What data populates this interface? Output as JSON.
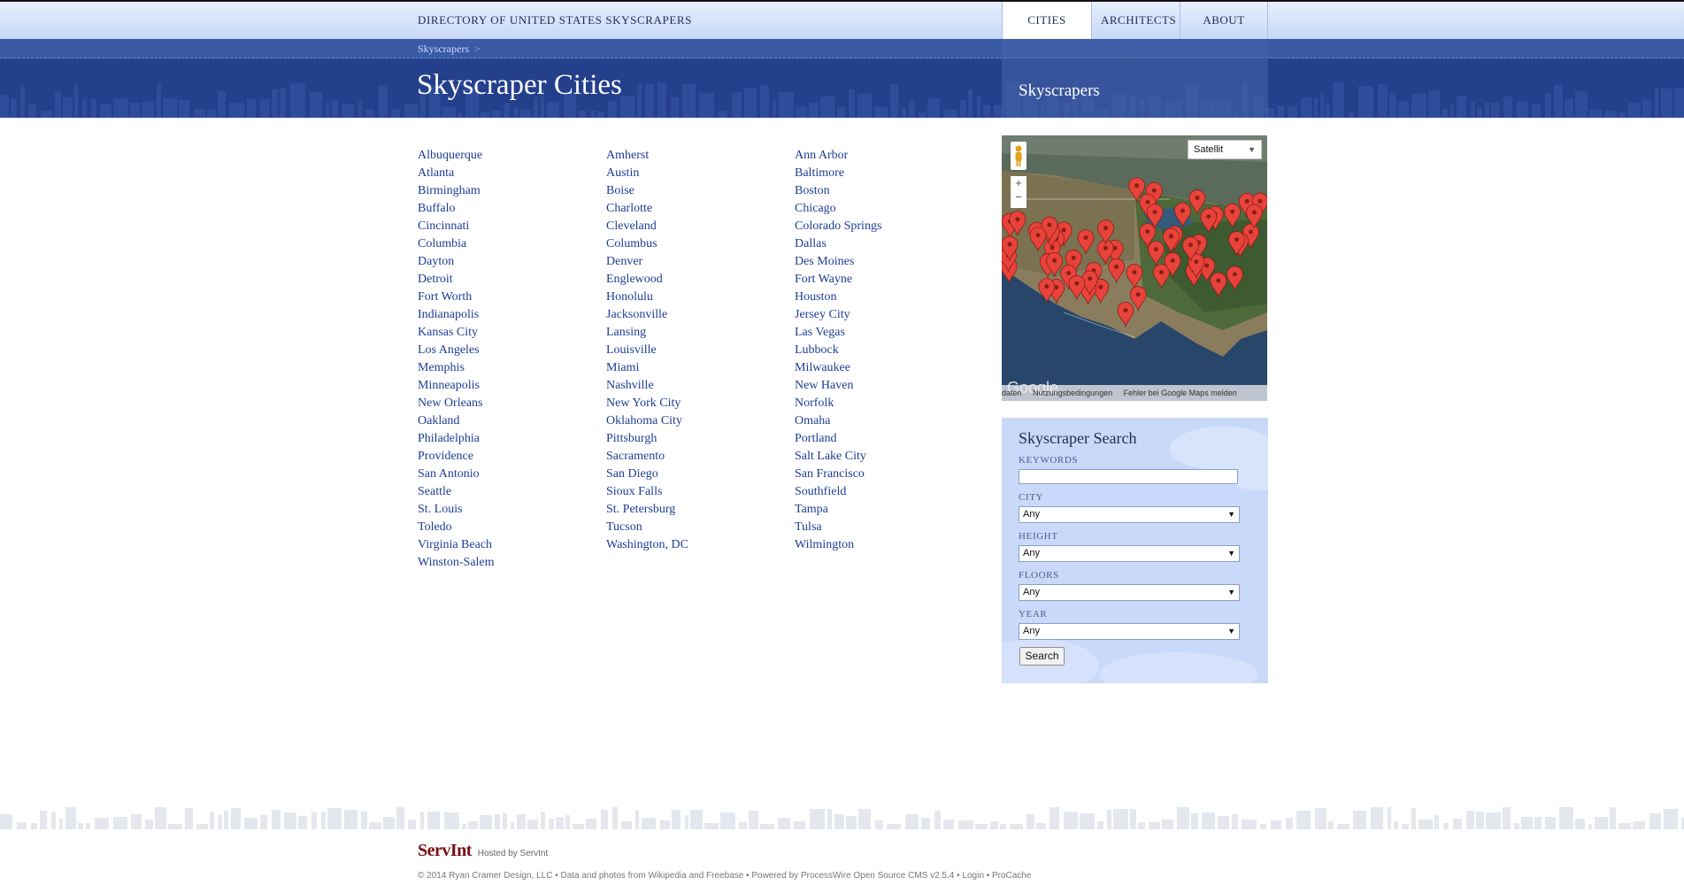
{
  "site": {
    "title": "DIRECTORY OF UNITED STATES SKYSCRAPERS"
  },
  "nav": [
    {
      "label": "CITIES"
    },
    {
      "label": "ARCHITECTS"
    },
    {
      "label": "ABOUT"
    }
  ],
  "breadcrumb": {
    "item": "Skyscrapers",
    "separator": ">"
  },
  "page": {
    "title": "Skyscraper Cities"
  },
  "sidebar": {
    "title": "Skyscrapers"
  },
  "cities": {
    "col1": [
      "Albuquerque",
      "Atlanta",
      "Birmingham",
      "Buffalo",
      "Cincinnati",
      "Columbia",
      "Dayton",
      "Detroit",
      "Fort Worth",
      "Indianapolis",
      "Kansas City",
      "Los Angeles",
      "Memphis",
      "Minneapolis",
      "New Orleans",
      "Oakland",
      "Philadelphia",
      "Providence",
      "San Antonio",
      "Seattle",
      "St. Louis",
      "Toledo",
      "Virginia Beach",
      "Winston-Salem"
    ],
    "col2": [
      "Amherst",
      "Austin",
      "Boise",
      "Charlotte",
      "Cleveland",
      "Columbus",
      "Denver",
      "Englewood",
      "Honolulu",
      "Jacksonville",
      "Lansing",
      "Louisville",
      "Miami",
      "Nashville",
      "New York City",
      "Oklahoma City",
      "Pittsburgh",
      "Sacramento",
      "San Diego",
      "Sioux Falls",
      "St. Petersburg",
      "Tucson",
      "Washington, DC"
    ],
    "col3": [
      "Ann Arbor",
      "Baltimore",
      "Boston",
      "Chicago",
      "Colorado Springs",
      "Dallas",
      "Des Moines",
      "Fort Wayne",
      "Houston",
      "Jersey City",
      "Las Vegas",
      "Lubbock",
      "Milwaukee",
      "New Haven",
      "Norfolk",
      "Omaha",
      "Portland",
      "Salt Lake City",
      "San Francisco",
      "Southfield",
      "Tampa",
      "Tulsa",
      "Wilmington"
    ]
  },
  "map": {
    "type_label": "Satellit",
    "zoom_in": "+",
    "zoom_out": "−",
    "footer": [
      "daten",
      "Nutzungsbedingungen",
      "Fehler bei Google Maps melden"
    ],
    "logo": "Google",
    "pin_color": "#e8433b",
    "pin_count": 60
  },
  "search": {
    "title": "Skyscraper Search",
    "keywords_label": "KEYWORDS",
    "keywords_value": "",
    "city_label": "CITY",
    "city_value": "Any",
    "height_label": "HEIGHT",
    "height_value": "Any",
    "floors_label": "FLOORS",
    "floors_value": "Any",
    "year_label": "YEAR",
    "year_value": "Any",
    "button": "Search"
  },
  "footer": {
    "logo_text": "ServInt",
    "hosted_by": "Hosted by",
    "host_link": "ServInt",
    "copyright_prefix": "© 2014 Ryan Cramer Design, LLC • Data and photos from Wikipedia and Freebase • Powered by",
    "cms_link": "ProcessWire Open Source CMS v2.5.4",
    "bullet": "•",
    "login_link": "Login",
    "procache": "• ProCache"
  },
  "colors": {
    "nav_bg": "#c7d8f7",
    "header_bg": "#243f8b",
    "link": "#1e3c96",
    "search_bg": "#c9d9fa"
  }
}
